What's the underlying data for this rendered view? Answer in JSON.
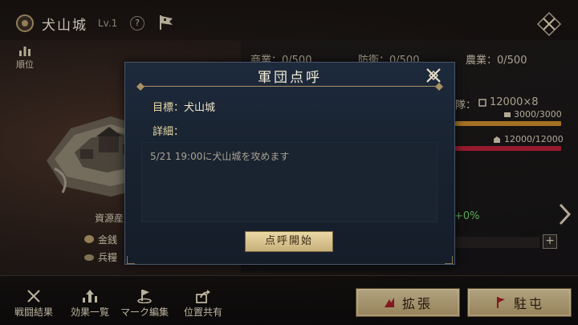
{
  "header": {
    "castle_name": "犬山城",
    "level": "Lv.1",
    "help_symbol": "?",
    "ranking_label": "順位"
  },
  "stats": {
    "commerce": "商業：0/500",
    "defense": "防衛：0/500",
    "agriculture": "農業：0/500",
    "troops_label": "隊：",
    "troops_value": "12000×8",
    "bar1_value": "3000/3000",
    "bar1_fill": 1.0,
    "bar2_value": "12000/12000",
    "bar2_fill": 1.0,
    "bonus": "+0%"
  },
  "resources": {
    "title": "資源産",
    "gold": "金銭",
    "food": "兵糧"
  },
  "bottom_nav": [
    {
      "label": "戦闘結果",
      "icon": "crossed-swords-icon"
    },
    {
      "label": "効果一覧",
      "icon": "arrow-up-bars-icon"
    },
    {
      "label": "マーク編集",
      "icon": "flag-marker-icon"
    },
    {
      "label": "位置共有",
      "icon": "share-icon"
    }
  ],
  "actions": {
    "expand": "拡張",
    "garrison": "駐屯"
  },
  "dialog": {
    "title": "軍団点呼",
    "target_key": "目標：",
    "target_value": "犬山城",
    "details_key": "詳細：",
    "details_text": "5/21 19:00に犬山城を攻めます",
    "start_button": "点呼開始"
  },
  "colors": {
    "accent_gold": "#c8b07a",
    "dialog_bg": "#18222f",
    "bar_gold": "#c98a2c",
    "bar_red": "#b8223a",
    "positive_green": "#6fcf6b"
  }
}
